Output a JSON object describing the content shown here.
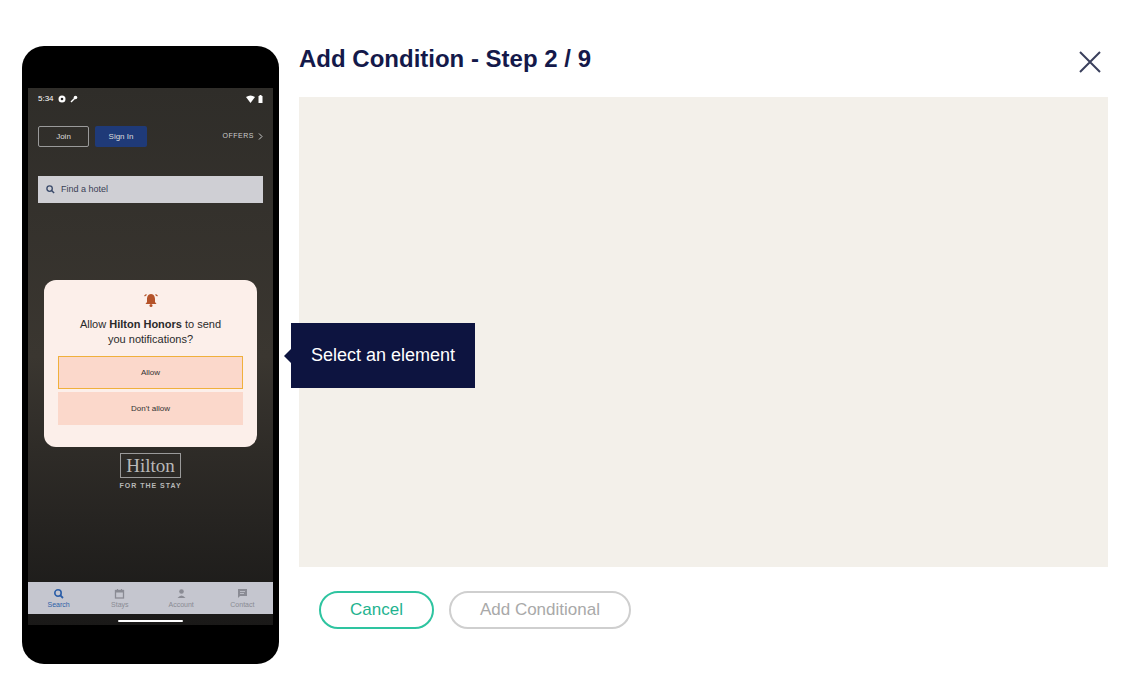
{
  "dialog": {
    "title": "Add Condition - Step 2 / 9"
  },
  "tooltip": "Select an element",
  "buttons": [
    {
      "label": "Cancel",
      "disabled": false
    },
    {
      "label": "Add Conditional",
      "disabled": true
    }
  ],
  "phone": {
    "status_time": "5:34",
    "header": {
      "join": "Join",
      "sign_in": "Sign In",
      "offers": "OFFERS"
    },
    "search": {
      "placeholder": "Find a hotel"
    },
    "prompt": {
      "text_before": "Allow ",
      "app": "Hilton Honors",
      "text_after": " to send you notifications?"
    },
    "options": [
      {
        "label": "Allow",
        "selected": true
      },
      {
        "label": "Don't allow",
        "selected": false
      }
    ],
    "logo": {
      "name": "Hilton",
      "tagline": "FOR THE STAY"
    },
    "nav": [
      {
        "label": "Search",
        "selected": true
      },
      {
        "label": "Stays",
        "selected": false
      },
      {
        "label": "Account",
        "selected": false
      },
      {
        "label": "Contact",
        "selected": false
      }
    ]
  }
}
